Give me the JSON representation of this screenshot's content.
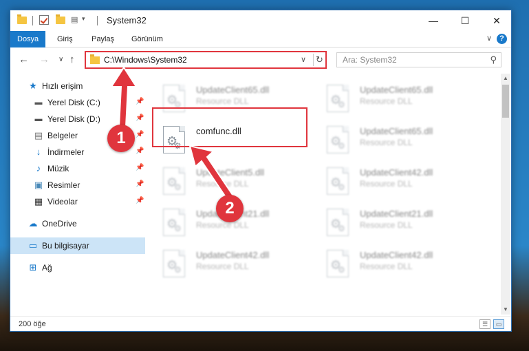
{
  "window": {
    "title": "System32",
    "minimize": "—",
    "maximize": "☐",
    "close": "✕"
  },
  "ribbon": {
    "tabs": [
      {
        "label": "Dosya"
      },
      {
        "label": "Giriş"
      },
      {
        "label": "Paylaş"
      },
      {
        "label": "Görünüm"
      }
    ],
    "help": "?",
    "expand": "∨"
  },
  "address": {
    "path": "C:\\Windows\\System32",
    "search_placeholder": "Ara: System32",
    "refresh": "↻",
    "chevron": "∨"
  },
  "nav": {
    "back": "←",
    "forward": "→",
    "recent": "∨",
    "up": "↑"
  },
  "sidebar": {
    "items": [
      {
        "label": "Hızlı erişim",
        "icon": "star-icon",
        "pinned": false
      },
      {
        "label": "Yerel Disk (C:)",
        "icon": "drive-icon",
        "pinned": true
      },
      {
        "label": "Yerel Disk (D:)",
        "icon": "drive-icon",
        "pinned": true
      },
      {
        "label": "Belgeler",
        "icon": "documents-icon",
        "pinned": true
      },
      {
        "label": "İndirmeler",
        "icon": "download-icon",
        "pinned": true
      },
      {
        "label": "Müzik",
        "icon": "music-icon",
        "pinned": true
      },
      {
        "label": "Resimler",
        "icon": "pictures-icon",
        "pinned": true
      },
      {
        "label": "Videolar",
        "icon": "videos-icon",
        "pinned": true
      },
      {
        "label": "OneDrive",
        "icon": "cloud-icon",
        "pinned": false
      },
      {
        "label": "Bu bilgisayar",
        "icon": "computer-icon",
        "pinned": false
      },
      {
        "label": "Ağ",
        "icon": "network-icon",
        "pinned": false
      }
    ]
  },
  "files": {
    "left": [
      {
        "name": "UpdateClient65.dll",
        "type": "Resource DLL"
      },
      {
        "name": "comfunc.dll",
        "type": ""
      },
      {
        "name": "UpdateClient5.dll",
        "type": "Resource DLL"
      },
      {
        "name": "UpdateClient21.dll",
        "type": "Resource DLL"
      },
      {
        "name": "UpdateClient42.dll",
        "type": "Resource DLL"
      }
    ],
    "right": [
      {
        "name": "UpdateClient65.dll",
        "type": "Resource DLL"
      },
      {
        "name": "UpdateClient65.dll",
        "type": "Resource DLL"
      },
      {
        "name": "UpdateClient42.dll",
        "type": "Resource DLL"
      },
      {
        "name": "UpdateClient21.dll",
        "type": "Resource DLL"
      },
      {
        "name": "UpdateClient42.dll",
        "type": "Resource DLL"
      }
    ]
  },
  "status": {
    "count": "200 öğe"
  },
  "callouts": {
    "one": "1",
    "two": "2"
  },
  "colors": {
    "accent": "#1979ca",
    "highlight": "#e0353d",
    "selected": "#cce4f7"
  }
}
